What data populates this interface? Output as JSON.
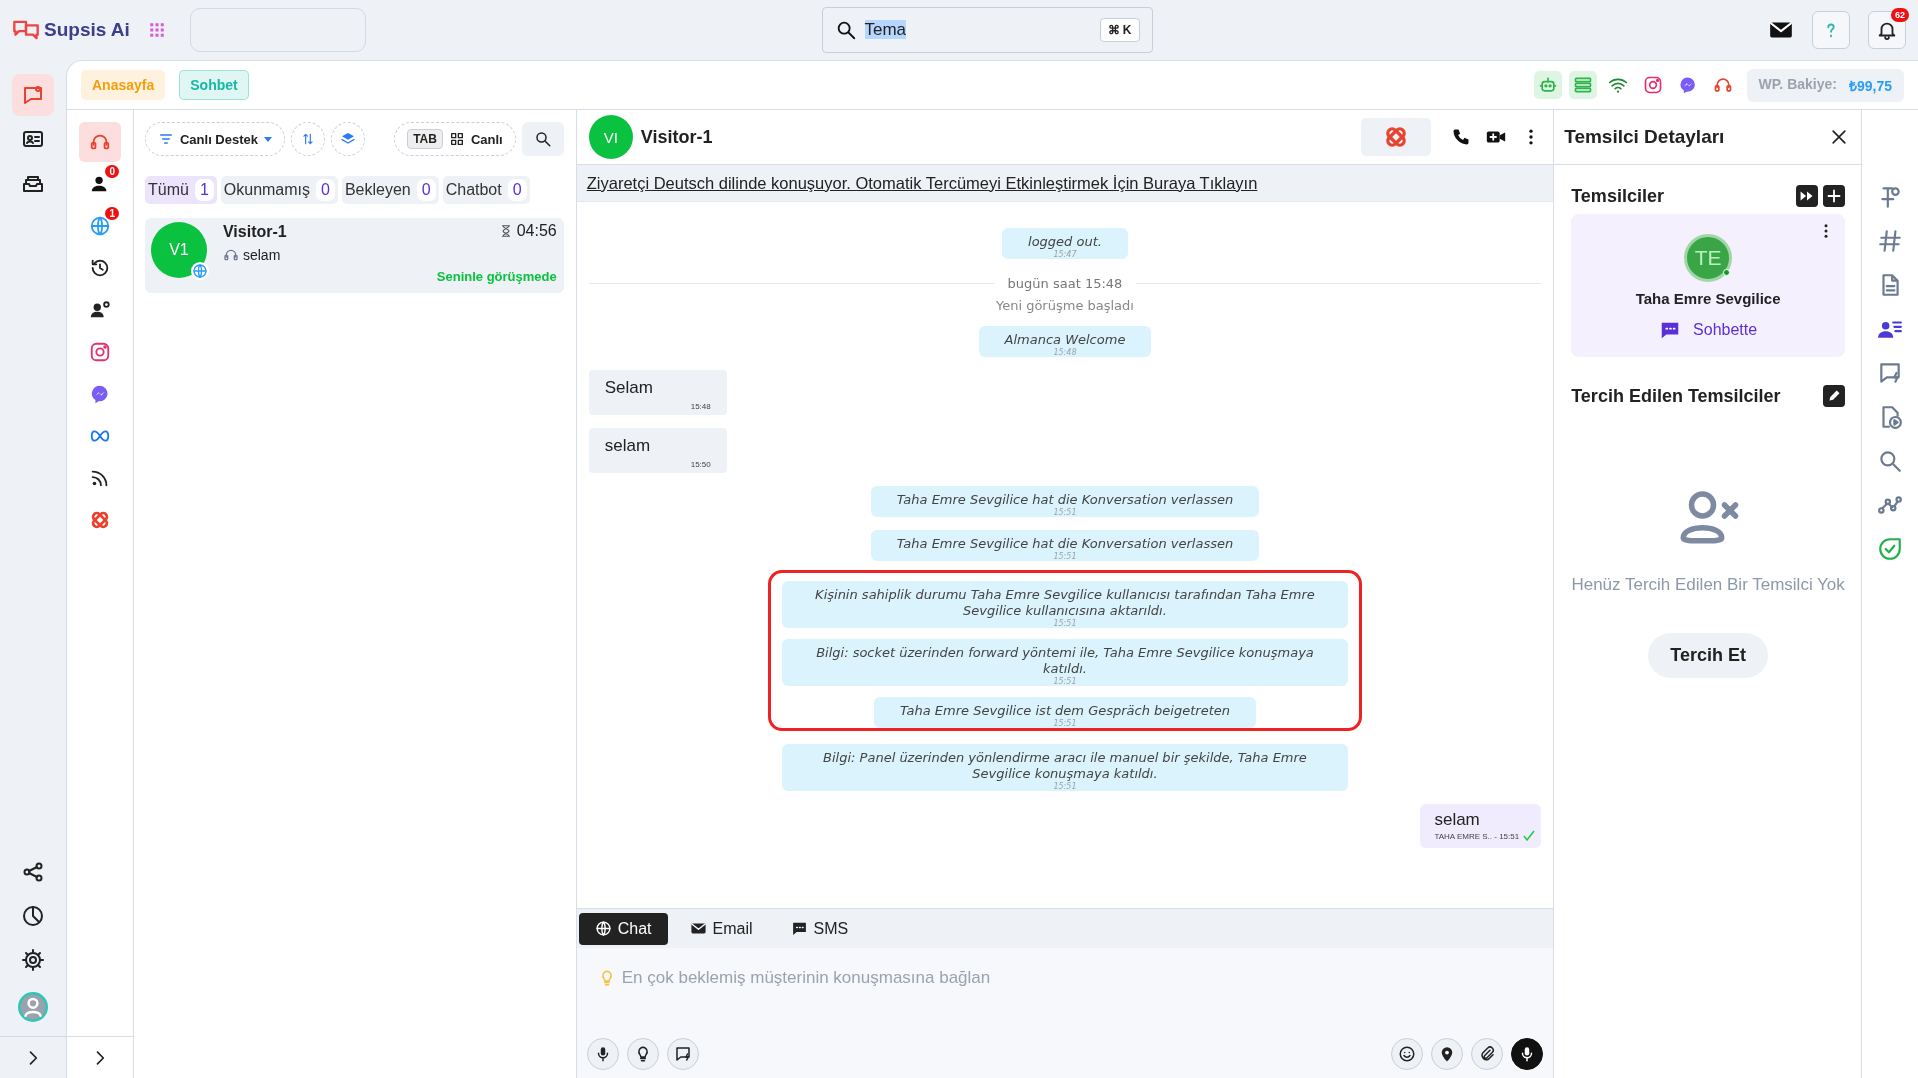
{
  "brand": {
    "name": "Supsis Ai"
  },
  "search": {
    "value": "Tema",
    "shortcut": "⌘ K"
  },
  "notifications": {
    "count": "62"
  },
  "main_nav": [
    {
      "kind": "chat",
      "selected": true
    },
    {
      "kind": "contact",
      "selected": false
    },
    {
      "kind": "inbox",
      "selected": false
    }
  ],
  "bottom_nav": [
    {
      "kind": "share"
    },
    {
      "kind": "pie"
    },
    {
      "kind": "gear"
    },
    {
      "kind": "avatar"
    }
  ],
  "page_tabs": [
    {
      "label": "Anasayfa",
      "selected": false,
      "color": "#f59e0b"
    },
    {
      "label": "Sohbet",
      "selected": true,
      "color": "#14b8a6"
    }
  ],
  "integrations": [
    {
      "kind": "robot"
    },
    {
      "kind": "list"
    },
    {
      "kind": "wifi"
    },
    {
      "kind": "instagram"
    },
    {
      "kind": "messenger"
    },
    {
      "kind": "headset"
    }
  ],
  "wp_balance": {
    "label": "WP. Bakiye:",
    "value": "₺99,75"
  },
  "channel_rail": [
    {
      "kind": "headset",
      "selected": true
    },
    {
      "kind": "people",
      "selected": false,
      "badge": "0"
    },
    {
      "kind": "globe",
      "selected": false,
      "badge": "1"
    },
    {
      "kind": "history",
      "selected": false
    },
    {
      "kind": "agents",
      "selected": false
    },
    {
      "kind": "instagram",
      "selected": false
    },
    {
      "kind": "messenger",
      "selected": false
    },
    {
      "kind": "infinity",
      "selected": false
    },
    {
      "kind": "rss",
      "selected": false
    },
    {
      "kind": "knot",
      "selected": false
    }
  ],
  "filter": {
    "label": "Canlı Destek",
    "tab_key": "TAB",
    "view": "Canlı"
  },
  "status_tabs": [
    {
      "label": "Tümü",
      "count": "1",
      "selected": true
    },
    {
      "label": "Okunmamış",
      "count": "0",
      "selected": false
    },
    {
      "label": "Bekleyen",
      "count": "0",
      "selected": false
    },
    {
      "label": "Chatbot",
      "count": "0",
      "selected": false
    }
  ],
  "conversations": [
    {
      "initials": "V1",
      "name": "Visitor-1",
      "time": "04:56",
      "preview": "selam",
      "status": "Seninle görüşmede",
      "selected": true
    }
  ],
  "chat": {
    "initials": "VI",
    "title": "Visitor-1",
    "banner": "Ziyaretçi Deutsch dilinde konuşuyor. Otomatik Tercümeyi Etkinleştirmek İçin Buraya Tıklayın",
    "messages": [
      {
        "kind": "system",
        "text": "logged out.",
        "time": "15:47",
        "highlighted": false
      },
      {
        "kind": "divider",
        "text": "bugün saat 15:48"
      },
      {
        "kind": "note",
        "text": "Yeni görüşme başladı"
      },
      {
        "kind": "system",
        "text": "Almanca Welcome",
        "time": "15:48",
        "highlighted": false
      },
      {
        "kind": "incoming",
        "text": "Selam",
        "time": "15:48"
      },
      {
        "kind": "incoming",
        "text": "selam",
        "time": "15:50"
      },
      {
        "kind": "system",
        "text": "Taha Emre Sevgilice hat die Konversation verlassen",
        "time": "15:51",
        "highlighted": false
      },
      {
        "kind": "system",
        "text": "Taha Emre Sevgilice hat die Konversation verlassen",
        "time": "15:51",
        "highlighted": false
      },
      {
        "kind": "system",
        "text": "Kişinin sahiplik durumu Taha Emre Sevgilice kullanıcısı tarafından Taha Emre Sevgilice kullanıcısına aktarıldı.",
        "time": "15:51",
        "highlighted": true
      },
      {
        "kind": "system",
        "text": "Bilgi: socket üzerinden forward yöntemi ile, Taha Emre Sevgilice konuşmaya katıldı.",
        "time": "15:51",
        "highlighted": true
      },
      {
        "kind": "system",
        "text": "Taha Emre Sevgilice ist dem Gespräch beigetreten",
        "time": "15:51",
        "highlighted": true
      },
      {
        "kind": "system",
        "text": "Bilgi: Panel üzerinden yönlendirme aracı ile manuel bir şekilde, Taha Emre Sevgilice konuşmaya katıldı.",
        "time": "15:51",
        "highlighted": false
      },
      {
        "kind": "outgoing",
        "text": "selam",
        "time": "TAHA EMRE S.. - 15:51",
        "read": true
      }
    ]
  },
  "composer": {
    "tabs": [
      {
        "kind": "globe",
        "label": "Chat",
        "selected": true
      },
      {
        "kind": "envelope",
        "label": "Email",
        "selected": false
      },
      {
        "kind": "sms",
        "label": "SMS",
        "selected": false
      }
    ],
    "placeholder": "En çok beklemiş müşterinin konuşmasına bağlan"
  },
  "agent_panel": {
    "title": "Temsilci Detayları",
    "agents_heading": "Temsilciler",
    "agent": {
      "initials": "TE",
      "name": "Taha Emre Sevgilice",
      "status": "Sohbette",
      "online": true
    },
    "preferred_heading": "Tercih Edilen Temsilciler",
    "empty_text": "Henüz Tercih Edilen Bir Temsilci Yok",
    "prefer_button": "Tercih Et"
  },
  "tool_rail": [
    {
      "kind": "pin",
      "selected": false
    },
    {
      "kind": "hash",
      "selected": false
    },
    {
      "kind": "document",
      "selected": false
    },
    {
      "kind": "contactlist",
      "selected": true
    },
    {
      "kind": "chatflash",
      "selected": false
    },
    {
      "kind": "fileplay",
      "selected": false
    },
    {
      "kind": "search",
      "selected": false
    },
    {
      "kind": "graph",
      "selected": false
    },
    {
      "kind": "shield",
      "selected": false
    }
  ]
}
